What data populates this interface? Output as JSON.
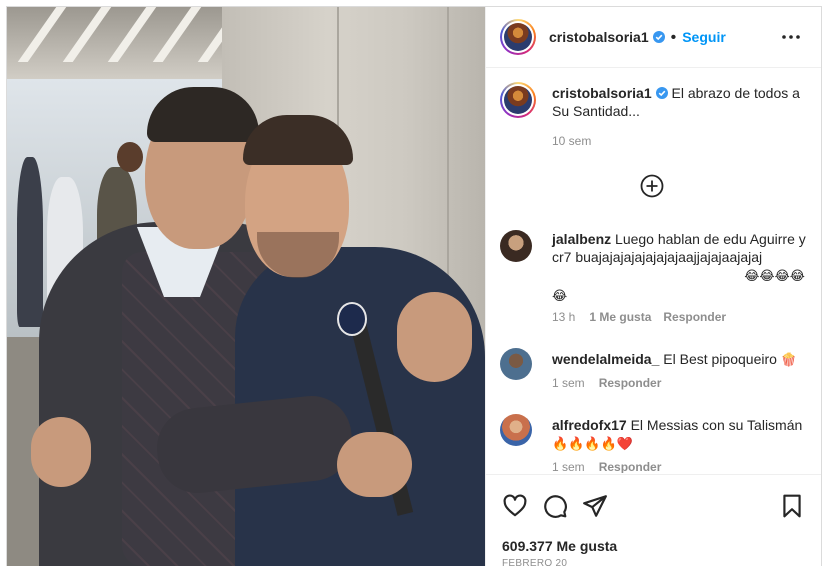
{
  "post": {
    "author": "cristobalsoria1",
    "follow_label": "Seguir",
    "caption": "El abrazo de todos a Su Santidad...",
    "caption_time": "10 sem",
    "likes": "609.377 Me gusta",
    "date": "FEBRERO 20"
  },
  "comments": [
    {
      "user": "jalalbenz",
      "text": "Luego hablan de edu Aguirre y cr7 buajajajajajajajajaajjajajaajajaj",
      "emoji_line1": "😂😂😂😂",
      "emoji_line2": "😂",
      "time": "13 h",
      "likes": "1 Me gusta",
      "reply": "Responder"
    },
    {
      "user": "wendelalmeida_",
      "text": "El Best pipoqueiro",
      "emoji": "🍿",
      "time": "1 sem",
      "reply": "Responder"
    },
    {
      "user": "alfredofx17",
      "text": "El Messias con su Talismán",
      "emoji": "🔥🔥🔥🔥❤️",
      "time": "1 sem",
      "reply": "Responder"
    }
  ],
  "icons": {
    "more": "more-options-icon",
    "verified": "verified-badge-icon",
    "load_more": "plus-circle-icon",
    "like": "heart-icon",
    "comment": "comment-icon",
    "share": "share-icon",
    "save": "bookmark-icon"
  },
  "colors": {
    "accent": "#0095f6",
    "verified": "#3897f0",
    "muted": "#8e8e8e",
    "text": "#262626"
  }
}
